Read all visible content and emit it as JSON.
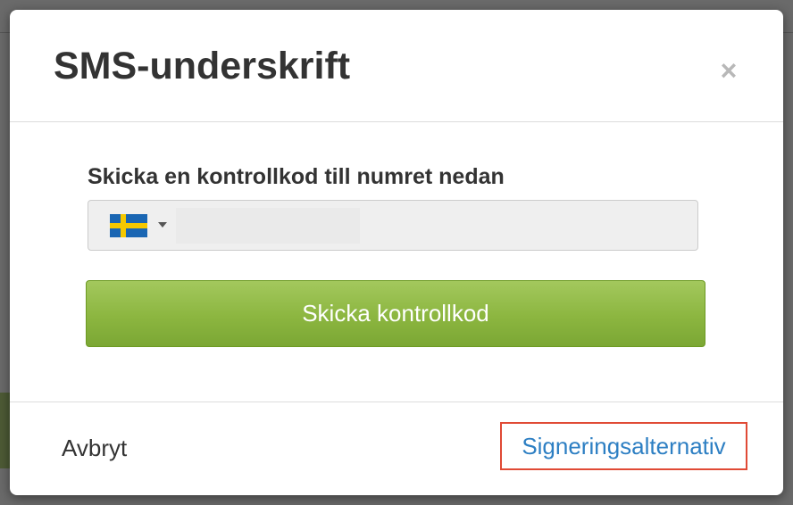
{
  "modal": {
    "title": "SMS-underskrift",
    "close_label": "×"
  },
  "body": {
    "phone_label": "Skicka en kontrollkod till numret nedan",
    "phone_input": {
      "value": "",
      "placeholder": ""
    },
    "country": {
      "selected": "Sweden",
      "flag_icon": "flag-sweden-icon",
      "flag_colors": {
        "blue": "#1a66b3",
        "yellow": "#f5c800"
      }
    },
    "send_button_label": "Skicka kontrollkod"
  },
  "footer": {
    "cancel_label": "Avbryt",
    "signing_options_label": "Signeringsalternativ"
  },
  "colors": {
    "primary_green": "#8cb640",
    "link_blue": "#2d7fc3",
    "highlight_red": "#e04a35",
    "title_text": "#333333"
  }
}
